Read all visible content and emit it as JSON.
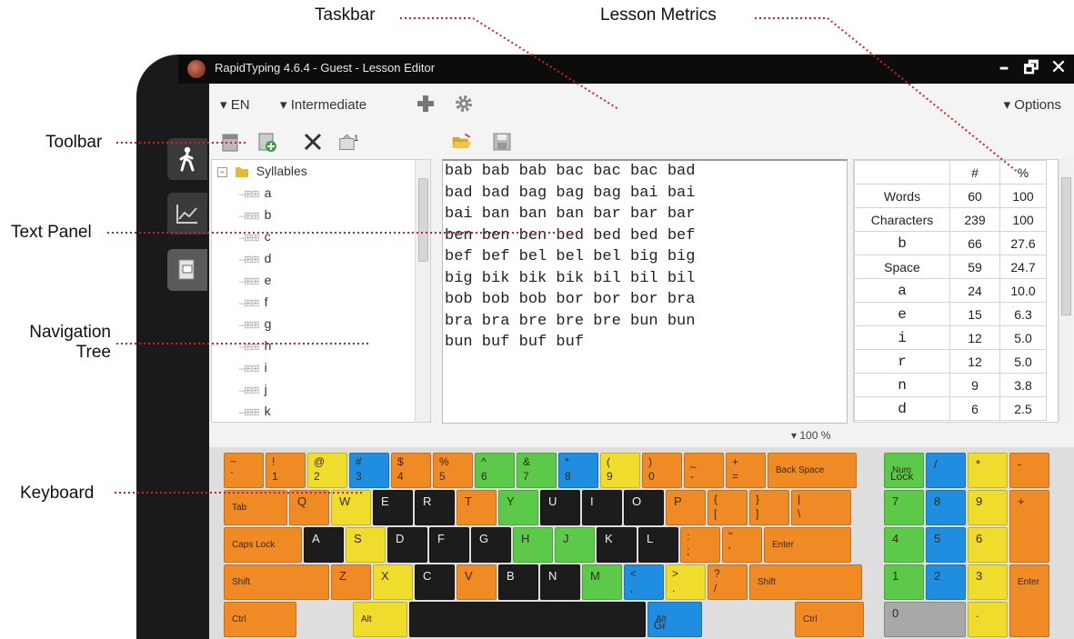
{
  "annotations": {
    "taskbar": "Taskbar",
    "lesson_metrics": "Lesson Metrics",
    "toolbar": "Toolbar",
    "text_panel": "Text Panel",
    "navigation_tree_line1": "Navigation",
    "navigation_tree_line2": "Tree",
    "keyboard": "Keyboard"
  },
  "window": {
    "title": "RapidTyping 4.6.4 - Guest - Lesson Editor",
    "minimize": "–",
    "restore": "🗗",
    "close": "✕"
  },
  "taskbar": {
    "language": "EN",
    "level": "Intermediate",
    "options": "Options",
    "dropdown_glyph": "▾"
  },
  "toolbar_icons": [
    "new-lesson-icon",
    "add-lesson-icon",
    "delete-icon",
    "rename-icon",
    "open-folder-icon",
    "save-icon"
  ],
  "tree": {
    "root": "Syllables",
    "items": [
      "a",
      "b",
      "c",
      "d",
      "e",
      "f",
      "g",
      "h",
      "i",
      "j",
      "k"
    ]
  },
  "text_panel": {
    "lines": [
      "bab bab bab bac bac bac bad",
      "bad bad bag bag bag bai bai",
      "bai ban ban ban bar bar bar",
      "ben ben ben bed bed bed bef",
      "bef bef bel bel bel big big",
      "big bik bik bik bil bil bil",
      "bob bob bob bor bor bor bra",
      "bra bra bre bre bre bun bun",
      "bun buf buf buf"
    ]
  },
  "metrics": {
    "headers": [
      "",
      "#",
      "%"
    ],
    "rows": [
      {
        "label": "Words",
        "count": "60",
        "pct": "100"
      },
      {
        "label": "Characters",
        "count": "239",
        "pct": "100"
      },
      {
        "label": "b",
        "count": "66",
        "pct": "27.6"
      },
      {
        "label": "Space",
        "count": "59",
        "pct": "24.7"
      },
      {
        "label": "a",
        "count": "24",
        "pct": "10.0"
      },
      {
        "label": "e",
        "count": "15",
        "pct": "6.3"
      },
      {
        "label": "i",
        "count": "12",
        "pct": "5.0"
      },
      {
        "label": "r",
        "count": "12",
        "pct": "5.0"
      },
      {
        "label": "n",
        "count": "9",
        "pct": "3.8"
      },
      {
        "label": "d",
        "count": "6",
        "pct": "2.5"
      }
    ]
  },
  "zoom": "▾ 100 %",
  "colors": {
    "orange": "#f08a24",
    "yellow": "#f0dc2c",
    "blue": "#1f8ee0",
    "green": "#5cc94a",
    "black": "#1c1c1c",
    "gray": "#a8a8a8"
  },
  "keyboard": {
    "rows": [
      [
        {
          "t": "~",
          "b": "`",
          "c": "orange"
        },
        {
          "t": "!",
          "b": "1",
          "c": "orange"
        },
        {
          "t": "@",
          "b": "2",
          "c": "yellow"
        },
        {
          "t": "#",
          "b": "3",
          "c": "blue"
        },
        {
          "t": "$",
          "b": "4",
          "c": "orange"
        },
        {
          "t": "%",
          "b": "5",
          "c": "orange"
        },
        {
          "t": "^",
          "b": "6",
          "c": "green"
        },
        {
          "t": "&",
          "b": "7",
          "c": "green"
        },
        {
          "t": "*",
          "b": "8",
          "c": "blue"
        },
        {
          "t": "(",
          "b": "9",
          "c": "yellow"
        },
        {
          "t": ")",
          "b": "0",
          "c": "orange"
        },
        {
          "t": "_",
          "b": "-",
          "c": "orange"
        },
        {
          "t": "+",
          "b": "=",
          "c": "orange"
        },
        {
          "t": "Back Space",
          "b": "",
          "c": "orange"
        }
      ],
      [
        {
          "t": "Tab",
          "b": "",
          "c": "orange"
        },
        {
          "t": "Q",
          "b": "",
          "c": "orange"
        },
        {
          "t": "W",
          "b": "",
          "c": "yellow"
        },
        {
          "t": "E",
          "b": "",
          "c": "black"
        },
        {
          "t": "R",
          "b": "",
          "c": "black"
        },
        {
          "t": "T",
          "b": "",
          "c": "orange"
        },
        {
          "t": "Y",
          "b": "",
          "c": "green"
        },
        {
          "t": "U",
          "b": "",
          "c": "black"
        },
        {
          "t": "I",
          "b": "",
          "c": "black"
        },
        {
          "t": "O",
          "b": "",
          "c": "black"
        },
        {
          "t": "P",
          "b": "",
          "c": "orange"
        },
        {
          "t": "{",
          "b": "[",
          "c": "orange"
        },
        {
          "t": "}",
          "b": "]",
          "c": "orange"
        },
        {
          "t": "|",
          "b": "\\",
          "c": "orange"
        }
      ],
      [
        {
          "t": "Caps Lock",
          "b": "",
          "c": "orange"
        },
        {
          "t": "A",
          "b": "",
          "c": "black"
        },
        {
          "t": "S",
          "b": "",
          "c": "yellow"
        },
        {
          "t": "D",
          "b": "",
          "c": "black"
        },
        {
          "t": "F",
          "b": "",
          "c": "black"
        },
        {
          "t": "G",
          "b": "",
          "c": "black"
        },
        {
          "t": "H",
          "b": "",
          "c": "green"
        },
        {
          "t": "J",
          "b": "",
          "c": "green"
        },
        {
          "t": "K",
          "b": "",
          "c": "black"
        },
        {
          "t": "L",
          "b": "",
          "c": "black"
        },
        {
          "t": ":",
          "b": ";",
          "c": "orange"
        },
        {
          "t": "\"",
          "b": "'",
          "c": "orange"
        },
        {
          "t": "Enter",
          "b": "",
          "c": "orange"
        }
      ],
      [
        {
          "t": "Shift",
          "b": "",
          "c": "orange"
        },
        {
          "t": "Z",
          "b": "",
          "c": "orange"
        },
        {
          "t": "X",
          "b": "",
          "c": "yellow"
        },
        {
          "t": "C",
          "b": "",
          "c": "black"
        },
        {
          "t": "V",
          "b": "",
          "c": "orange"
        },
        {
          "t": "B",
          "b": "",
          "c": "black"
        },
        {
          "t": "N",
          "b": "",
          "c": "black"
        },
        {
          "t": "M",
          "b": "",
          "c": "green"
        },
        {
          "t": "<",
          "b": ",",
          "c": "blue"
        },
        {
          "t": ">",
          "b": ".",
          "c": "yellow"
        },
        {
          "t": "?",
          "b": "/",
          "c": "orange"
        },
        {
          "t": "Shift",
          "b": "",
          "c": "orange"
        }
      ],
      [
        {
          "t": "Ctrl",
          "b": "",
          "c": "orange"
        },
        {
          "t": "Alt",
          "b": "",
          "c": "yellow"
        },
        {
          "t": "",
          "b": "",
          "c": "black"
        },
        {
          "t": "Alt",
          "b": "Gr",
          "c": "blue"
        },
        {
          "t": "Ctrl",
          "b": "",
          "c": "orange"
        }
      ]
    ],
    "numpad": [
      {
        "t": "Num",
        "b": "Lock",
        "c": "green"
      },
      {
        "t": "/",
        "b": "",
        "c": "blue"
      },
      {
        "t": "*",
        "b": "",
        "c": "yellow"
      },
      {
        "t": "-",
        "b": "",
        "c": "orange"
      },
      {
        "t": "7",
        "b": "",
        "c": "green"
      },
      {
        "t": "8",
        "b": "",
        "c": "blue"
      },
      {
        "t": "9",
        "b": "",
        "c": "yellow"
      },
      {
        "t": "+",
        "b": "",
        "c": "orange"
      },
      {
        "t": "4",
        "b": "",
        "c": "green"
      },
      {
        "t": "5",
        "b": "",
        "c": "blue"
      },
      {
        "t": "6",
        "b": "",
        "c": "yellow"
      },
      {
        "t": "1",
        "b": "",
        "c": "green"
      },
      {
        "t": "2",
        "b": "",
        "c": "blue"
      },
      {
        "t": "3",
        "b": "",
        "c": "yellow"
      },
      {
        "t": "Enter",
        "b": "",
        "c": "orange"
      },
      {
        "t": "0",
        "b": "",
        "c": "gray"
      },
      {
        "t": ".",
        "b": "",
        "c": "yellow"
      }
    ]
  }
}
